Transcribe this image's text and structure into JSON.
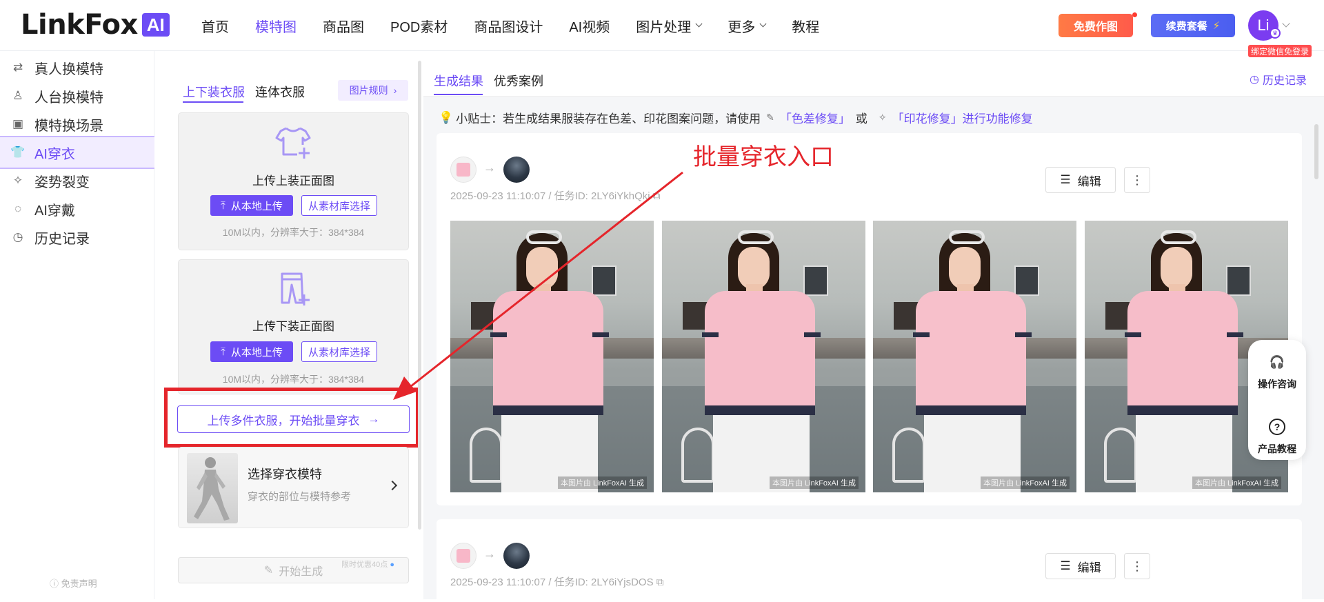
{
  "header": {
    "logo_text": "LinkFox",
    "logo_badge": "AI",
    "nav": [
      {
        "label": "首页",
        "active": false,
        "dropdown": false
      },
      {
        "label": "模特图",
        "active": true,
        "dropdown": false
      },
      {
        "label": "商品图",
        "active": false,
        "dropdown": false
      },
      {
        "label": "POD素材",
        "active": false,
        "dropdown": false
      },
      {
        "label": "商品图设计",
        "active": false,
        "dropdown": false
      },
      {
        "label": "AI视频",
        "active": false,
        "dropdown": false
      },
      {
        "label": "图片处理",
        "active": false,
        "dropdown": true
      },
      {
        "label": "更多",
        "active": false,
        "dropdown": true
      },
      {
        "label": "教程",
        "active": false,
        "dropdown": false
      }
    ],
    "free_button": "免费作图",
    "renew_button": "续费套餐",
    "renew_icon": "⚡",
    "avatar_text": "Li",
    "wechat_tag": "绑定微信免登录"
  },
  "sidebar": {
    "items": [
      {
        "label": "真人换模特",
        "icon": "person-swap-icon"
      },
      {
        "label": "人台换模特",
        "icon": "mannequin-icon"
      },
      {
        "label": "模特换场景",
        "icon": "scene-icon"
      },
      {
        "label": "AI穿衣",
        "icon": "shirt-icon",
        "active": true
      },
      {
        "label": "姿势裂变",
        "icon": "pose-icon"
      },
      {
        "label": "AI穿戴",
        "icon": "accessory-icon"
      },
      {
        "label": "历史记录",
        "icon": "history-icon"
      }
    ],
    "disclaimer": "免责声明"
  },
  "panel": {
    "tabs": {
      "top_bottom": "上下装衣服",
      "one_piece": "连体衣服"
    },
    "rules_button": "图片规则",
    "upload_top": {
      "title": "上传上装正面图",
      "local_button": "从本地上传",
      "library_button": "从素材库选择",
      "hint": "10M以内，分辨率大于：384*384"
    },
    "upload_bottom": {
      "title": "上传下装正面图",
      "local_button": "从本地上传",
      "library_button": "从素材库选择",
      "hint": "10M以内，分辨率大于：384*384"
    },
    "batch_button": "上传多件衣服，开始批量穿衣",
    "model": {
      "title": "选择穿衣模特",
      "subtitle": "穿衣的部位与模特参考"
    },
    "generate_button": "开始生成",
    "generate_promo": "限时优惠40点"
  },
  "main": {
    "tabs": {
      "results": "生成结果",
      "cases": "优秀案例"
    },
    "history_link": "历史记录",
    "tip": {
      "prefix": "小贴士：若生成结果服装存在色差、印花图案问题，请使用",
      "link1": "「色差修复」",
      "mid": "或",
      "link2": "「印花修复」进行功能修复"
    },
    "results": [
      {
        "meta": "2025-09-23 11:10:07 / 任务ID: 2LY6iYkhQki",
        "edit": "编辑",
        "watermark": "本图片由 LinkFoxAI 生成"
      },
      {
        "meta": "2025-09-23 11:10:07 / 任务ID: 2LY6iYjsDOS",
        "edit": "编辑",
        "watermark": "本图片由 LinkFoxAI 生成"
      }
    ]
  },
  "floating": {
    "consult": "操作咨询",
    "tutorial": "产品教程"
  },
  "annotation": {
    "text": "批量穿衣入口",
    "color": "#e5252b"
  },
  "colors": {
    "accent": "#6c4cf5",
    "annotation": "#e5252b",
    "free_button": "#ff6a48",
    "renew_button": "#5265f2"
  }
}
